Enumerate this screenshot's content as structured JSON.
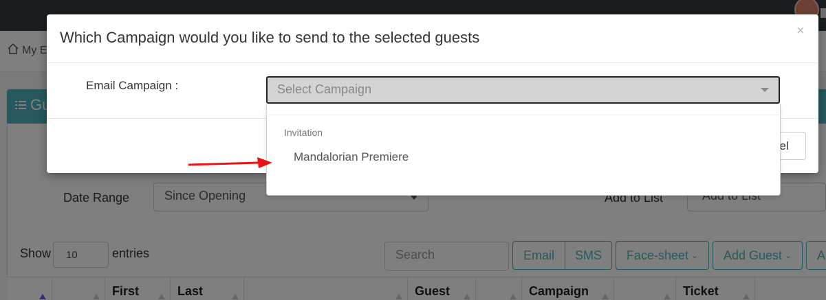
{
  "background": {
    "breadcrumb": "My E",
    "panel_title": "Gu",
    "date_range_label": "Date Range",
    "date_range_value": "Since Opening",
    "add_to_list_label": "Add to List",
    "add_to_list_value": "Add to List",
    "show_label": "Show",
    "entries_value": "10",
    "entries_label": "entries",
    "search_placeholder": "Search",
    "buttons": {
      "email": "Email",
      "sms": "SMS",
      "face_sheet": "Face-sheet",
      "add_guest": "Add Guest",
      "more": "A"
    },
    "columns": [
      "First",
      "Last",
      "Guest",
      "Campaign",
      "Ticket"
    ]
  },
  "modal": {
    "title": "Which Campaign would you like to send to the selected guests",
    "close": "×",
    "field_label": "Email Campaign :",
    "select_placeholder": "Select Campaign",
    "cancel_label": "cel",
    "dropdown": {
      "group_label": "Invitation",
      "options": [
        "Mandalorian Premiere"
      ]
    }
  },
  "colors": {
    "accent": "#4fb3bf",
    "arrow": "#e81414",
    "topbar": "#343a40"
  }
}
